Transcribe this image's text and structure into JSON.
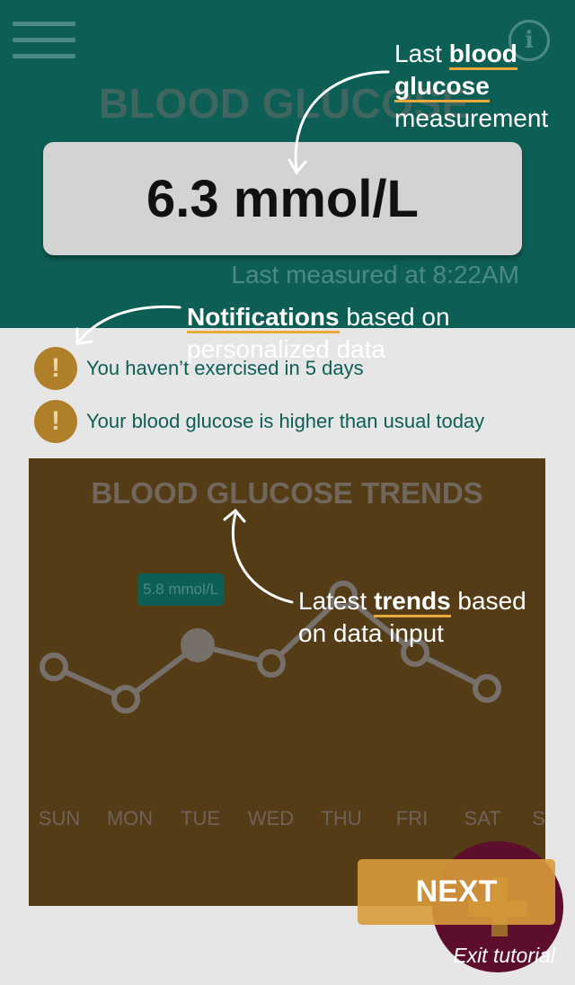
{
  "header": {
    "title": "BLOOD GLUCOSE",
    "reading": "6.3 mmol/L",
    "last_measured": "Last measured at 8:22AM"
  },
  "notifications": [
    "You haven’t exercised in 5 days",
    "Your blood glucose is higher than usual today"
  ],
  "trends": {
    "title": "BLOOD GLUCOSE TRENDS",
    "tooltip": "5.8 mmol/L"
  },
  "chart_data": {
    "type": "line",
    "categories": [
      "SUN",
      "MON",
      "TUE",
      "WED",
      "THU",
      "FRI",
      "SAT",
      "SUN"
    ],
    "point_categories": [
      "SUN",
      "MON",
      "TUE",
      "WED",
      "THU",
      "FRI",
      "SAT"
    ],
    "values": [
      5.2,
      4.3,
      5.8,
      5.3,
      7.2,
      5.6,
      4.6
    ],
    "highlighted_value": "5.8 mmol/L",
    "highlighted_index": 2,
    "title": "BLOOD GLUCOSE TRENDS",
    "xlabel": "",
    "ylabel": "",
    "ylim": [
      3,
      8.5
    ]
  },
  "tutorial": {
    "annot1_line1_prefix": "Last ",
    "annot1_line1_bold": "blood",
    "annot1_line2_bold": "glucose",
    "annot1_line3": "measurement",
    "annot2_bold": "Notifications",
    "annot2_rest": " based on",
    "annot2_line2": "personalized data",
    "annot3_prefix": "Latest ",
    "annot3_bold": "trends",
    "annot3_rest": " based",
    "annot3_line2": "on data input",
    "next_label": "NEXT",
    "exit_label": "Exit tutorial"
  },
  "colors": {
    "header_bg": "#0d5f55",
    "accent": "#e8a93a",
    "trends_bg": "#543c16",
    "fab": "#5d0e2c"
  },
  "icons": [
    "menu-icon",
    "info-icon",
    "alert-icon",
    "plus-icon",
    "arrow-icon"
  ]
}
